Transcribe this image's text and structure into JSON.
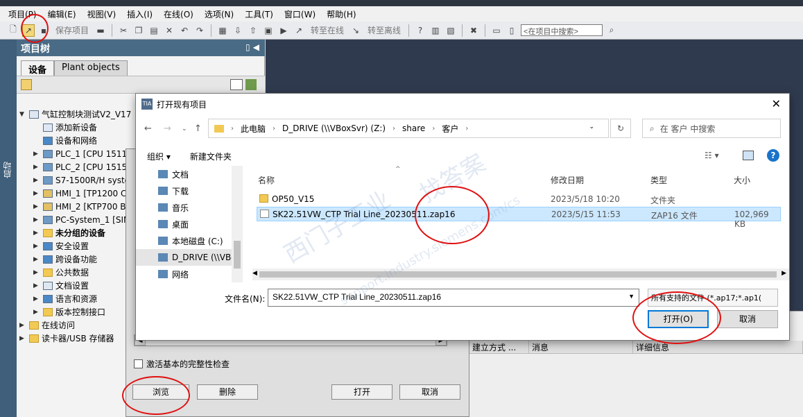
{
  "menu": [
    "项目(P)",
    "编辑(E)",
    "视图(V)",
    "插入(I)",
    "在线(O)",
    "选项(N)",
    "工具(T)",
    "窗口(W)",
    "帮助(H)"
  ],
  "toolbar": {
    "save_project": "保存项目",
    "go_online": "转至在线",
    "go_offline": "转至离线",
    "search_placeholder": "<在项目中搜索>"
  },
  "side": {
    "start_label": "启动"
  },
  "project_tree": {
    "title": "项目树",
    "tabs": [
      "设备",
      "Plant objects"
    ],
    "items": [
      {
        "label": "气缸控制块测试V2_V17",
        "level": 0,
        "arrow": "▼",
        "icon": "doc",
        "bold": false
      },
      {
        "label": "添加新设备",
        "level": 1,
        "arrow": "",
        "icon": "add",
        "bold": false
      },
      {
        "label": "设备和网络",
        "level": 1,
        "arrow": "",
        "icon": "net",
        "bold": false
      },
      {
        "label": "PLC_1 [CPU 1511-",
        "level": 1,
        "arrow": "▶",
        "icon": "pc",
        "bold": false
      },
      {
        "label": "PLC_2 [CPU 1515-",
        "level": 1,
        "arrow": "▶",
        "icon": "pc",
        "bold": false
      },
      {
        "label": "S7-1500R/H syste",
        "level": 1,
        "arrow": "▶",
        "icon": "pc",
        "bold": false
      },
      {
        "label": "HMI_1 [TP1200 C",
        "level": 1,
        "arrow": "▶",
        "icon": "hmi",
        "bold": false
      },
      {
        "label": "HMI_2 [KTP700 B",
        "level": 1,
        "arrow": "▶",
        "icon": "hmi",
        "bold": false
      },
      {
        "label": "PC-System_1 [SIM",
        "level": 1,
        "arrow": "▶",
        "icon": "pc",
        "bold": false
      },
      {
        "label": "未分组的设备",
        "level": 1,
        "arrow": "▶",
        "icon": "fold",
        "bold": true
      },
      {
        "label": "安全设置",
        "level": 1,
        "arrow": "▶",
        "icon": "net",
        "bold": false
      },
      {
        "label": "跨设备功能",
        "level": 1,
        "arrow": "▶",
        "icon": "net",
        "bold": false
      },
      {
        "label": "公共数据",
        "level": 1,
        "arrow": "▶",
        "icon": "fold",
        "bold": false
      },
      {
        "label": "文档设置",
        "level": 1,
        "arrow": "▶",
        "icon": "doc",
        "bold": false
      },
      {
        "label": "语言和资源",
        "level": 1,
        "arrow": "▶",
        "icon": "net",
        "bold": false
      },
      {
        "label": "版本控制接口",
        "level": 1,
        "arrow": "▶",
        "icon": "fold",
        "bold": false
      },
      {
        "label": "在线访问",
        "level": 0,
        "arrow": "▶",
        "icon": "fold",
        "bold": false
      },
      {
        "label": "读卡器/USB 存储器",
        "level": 0,
        "arrow": "▶",
        "icon": "fold",
        "bold": false
      }
    ]
  },
  "inspector": {
    "columns": [
      "建立方式 ...",
      "消息",
      "详细信息"
    ]
  },
  "under_dialog": {
    "checkbox_label": "激活基本的完整性检查",
    "browse": "浏览",
    "delete": "删除",
    "open": "打开",
    "cancel": "取消"
  },
  "open_dialog": {
    "title": "打开现有项目",
    "breadcrumb": [
      "此电脑",
      "D_DRIVE (\\\\VBoxSvr) (Z:)",
      "share",
      "客户"
    ],
    "search_placeholder": "在 客户 中搜索",
    "organize": "组织 ▾",
    "new_folder": "新建文件夹",
    "nav": [
      {
        "label": "文档",
        "sel": false
      },
      {
        "label": "下载",
        "sel": false
      },
      {
        "label": "音乐",
        "sel": false
      },
      {
        "label": "桌面",
        "sel": false
      },
      {
        "label": "本地磁盘 (C:)",
        "sel": false
      },
      {
        "label": "D_DRIVE (\\\\VBo",
        "sel": true
      },
      {
        "label": "网络",
        "sel": false
      }
    ],
    "columns": {
      "name": "名称",
      "date": "修改日期",
      "type": "类型",
      "size": "大小"
    },
    "files": [
      {
        "name": "OP50_V15",
        "date": "2023/5/18 10:20",
        "type": "文件夹",
        "size": "",
        "selected": false,
        "folder": true
      },
      {
        "name": "SK22.51VW_CTP Trial Line_20230511.zap16",
        "date": "2023/5/15 11:53",
        "type": "ZAP16 文件",
        "size": "102,969 KB",
        "selected": true,
        "folder": false
      }
    ],
    "filename_label": "文件名(N):",
    "filename_value": "SK22.51VW_CTP Trial Line_20230511.zap16",
    "filetype": "所有支持的文件 (*.ap17;*.ap1(",
    "open_button": "打开(O)",
    "cancel_button": "取消"
  },
  "watermark": [
    "西门子工业",
    "找答案",
    "support.industry.siemens.com/cs"
  ]
}
